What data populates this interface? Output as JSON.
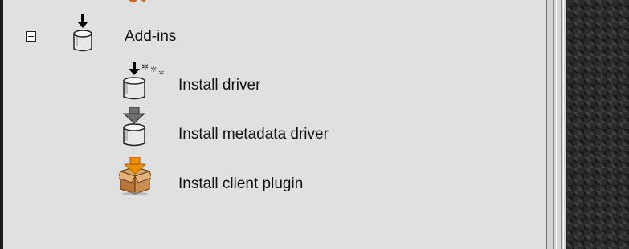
{
  "tree": {
    "parent": {
      "label": "Add-ins",
      "icon": "database-install-icon",
      "expanded": true
    },
    "children": [
      {
        "label": "Install driver",
        "icon": "database-gears-icon"
      },
      {
        "label": "Install metadata driver",
        "icon": "database-arrow-icon"
      },
      {
        "label": "Install client plugin",
        "icon": "package-arrow-icon"
      }
    ]
  },
  "colors": {
    "panel_bg": "#e0e0e0",
    "arrow_orange": "#f08c00",
    "box_tan": "#c48a4a"
  }
}
